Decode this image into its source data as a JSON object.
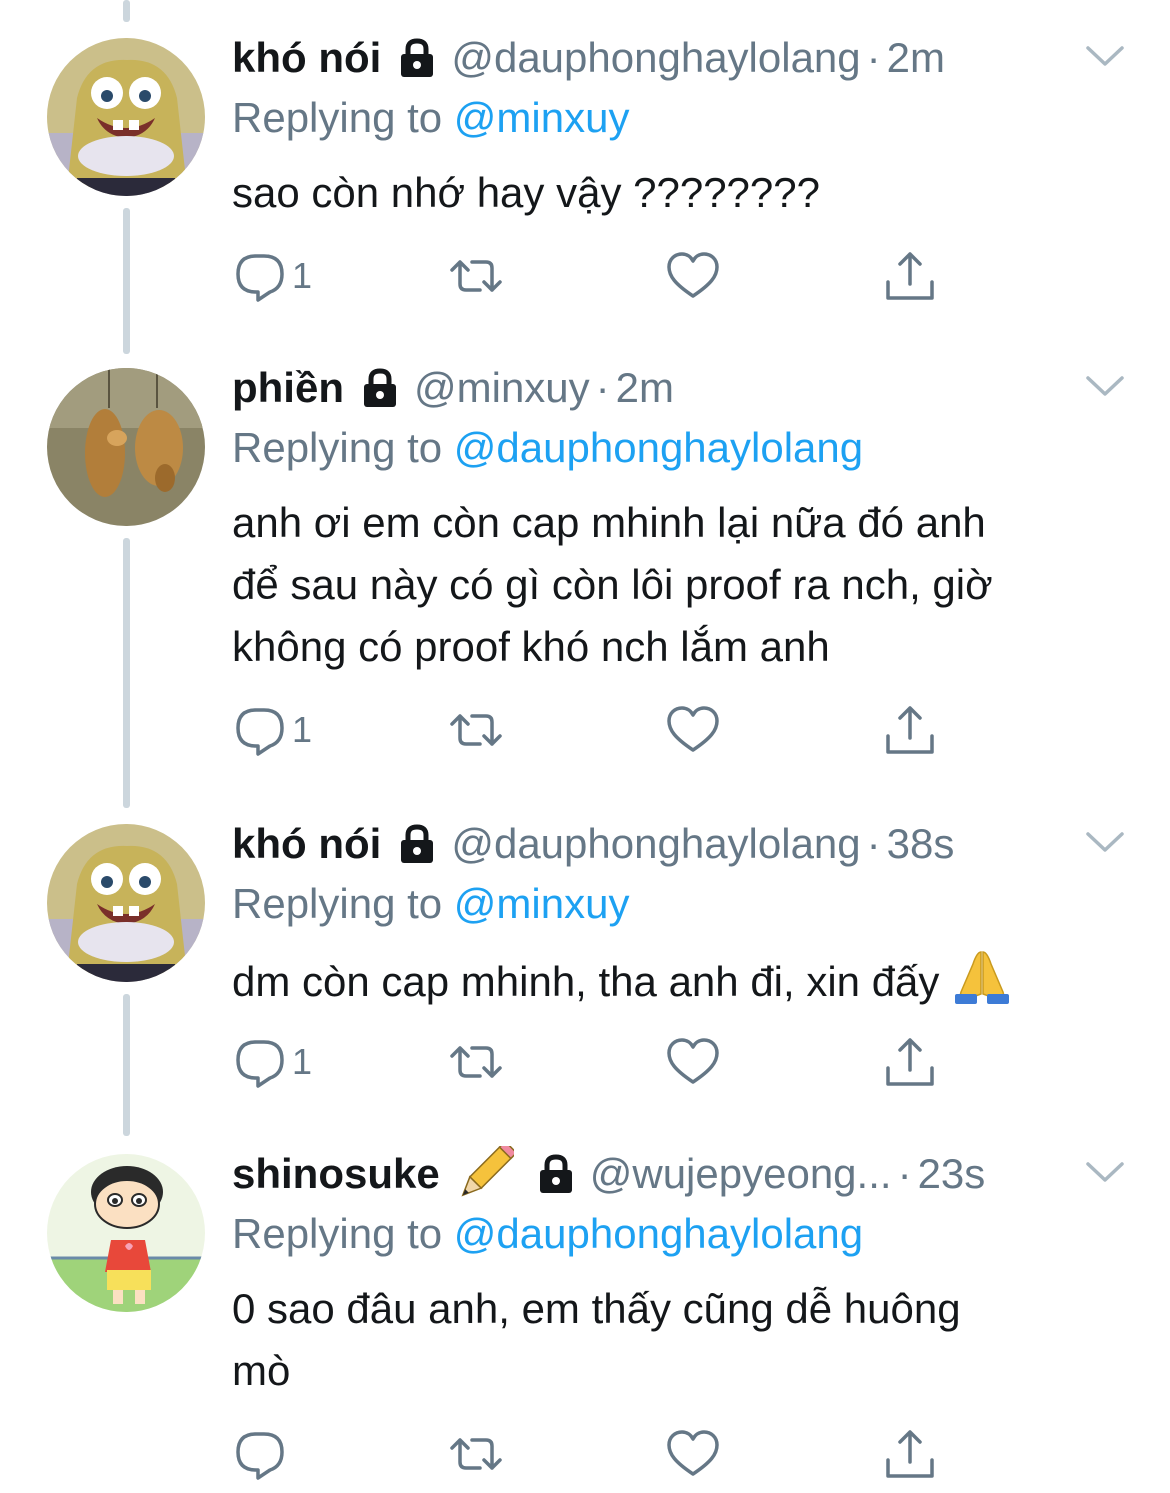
{
  "tweets": [
    {
      "name": "khó nói",
      "handle": "@dauphonghaylolang",
      "dot": "·",
      "time": "2m",
      "replying_prefix": "Replying to",
      "replying_to": "@minxuy",
      "text_lines": [
        "sao còn nhớ hay vậy ????????"
      ],
      "reply_count": "1"
    },
    {
      "name": "phiền",
      "handle": "@minxuy",
      "dot": "·",
      "time": "2m",
      "replying_prefix": "Replying to",
      "replying_to": "@dauphonghaylolang",
      "text_lines": [
        "anh ơi em còn cap mhinh lại nữa đó anh",
        "để sau này có gì còn lôi proof ra nch, giờ",
        "không có proof khó nch lắm anh"
      ],
      "reply_count": "1"
    },
    {
      "name": "khó nói",
      "handle": "@dauphonghaylolang",
      "dot": "·",
      "time": "38s",
      "replying_prefix": "Replying to",
      "replying_to": "@minxuy",
      "text_lines": [
        "dm còn cap mhinh, tha anh đi, xin đấy"
      ],
      "reply_count": "1"
    },
    {
      "name": "shinosuke",
      "handle": "@wujepyeong...",
      "dot": "·",
      "time": "23s",
      "replying_prefix": "Replying to",
      "replying_to": "@dauphonghaylolang",
      "text_lines": [
        "0 sao đâu anh, em thấy cũng dễ huông",
        "mò"
      ],
      "reply_count": ""
    }
  ],
  "icons": {
    "reply": "reply-icon",
    "retweet": "retweet-icon",
    "like": "heart-icon",
    "share": "share-icon",
    "lock": "lock-icon",
    "caret": "chevron-down-icon",
    "pencil": "pencil-emoji",
    "pray": "folded-hands-emoji"
  },
  "colors": {
    "link": "#1da1f2",
    "secondary_text": "#657786",
    "thread_line": "#ccd6dd"
  }
}
